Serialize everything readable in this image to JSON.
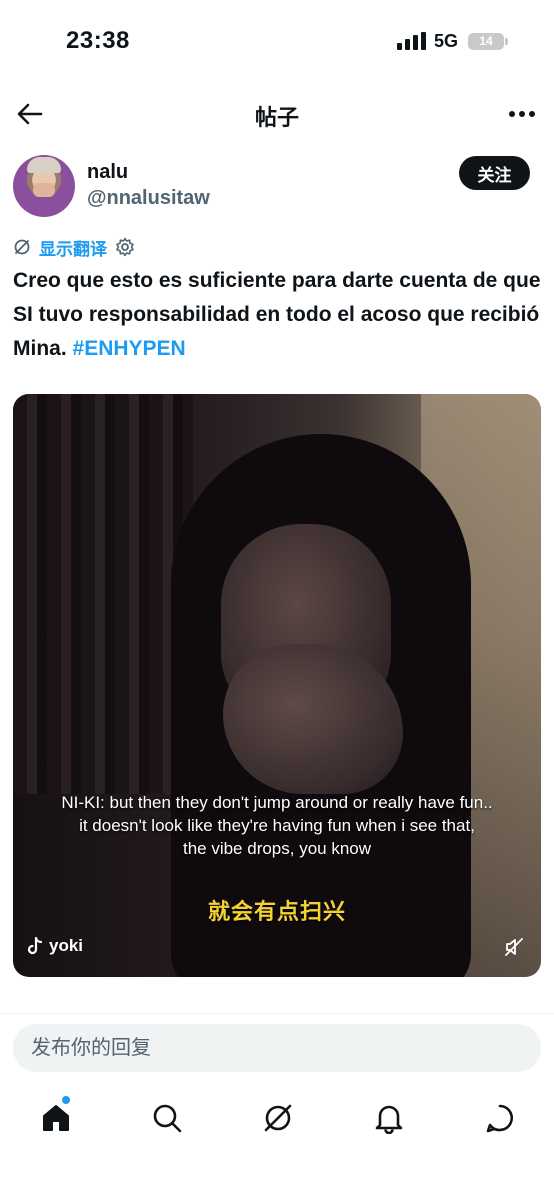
{
  "status_bar": {
    "time": "23:38",
    "network": "5G",
    "battery_level": "14"
  },
  "header": {
    "title": "帖子",
    "back_icon": "arrow-left-icon",
    "more_icon": "more-horizontal-icon"
  },
  "post": {
    "author": {
      "display_name": "nalu",
      "handle": "@nnalusitaw"
    },
    "follow_label": "关注",
    "translate_label": "显示翻译",
    "text_main": "Creo que esto es suficiente para darte cuenta de que SI tuvo responsabilidad en todo el acoso que recibió Mina. ",
    "hashtag": "#ENHYPEN",
    "media": {
      "caption_en_line1": "NI-KI: but then they don't jump around or really have fun..",
      "caption_en_line2": "it doesn't look like they're having fun when i see that,",
      "caption_en_line3": "the vibe drops, you know",
      "caption_zh": "就会有点扫兴",
      "source_label": "yoki",
      "muted": true
    }
  },
  "reply": {
    "placeholder": "发布你的回复"
  },
  "tab_bar": {
    "items": [
      "home-icon",
      "search-icon",
      "grok-icon",
      "notifications-icon",
      "messages-icon"
    ],
    "has_notification_dot": true
  },
  "colors": {
    "accent": "#1d9bf0",
    "text_primary": "#0f1419",
    "text_secondary": "#536471",
    "caption_yellow": "#f5d232"
  }
}
